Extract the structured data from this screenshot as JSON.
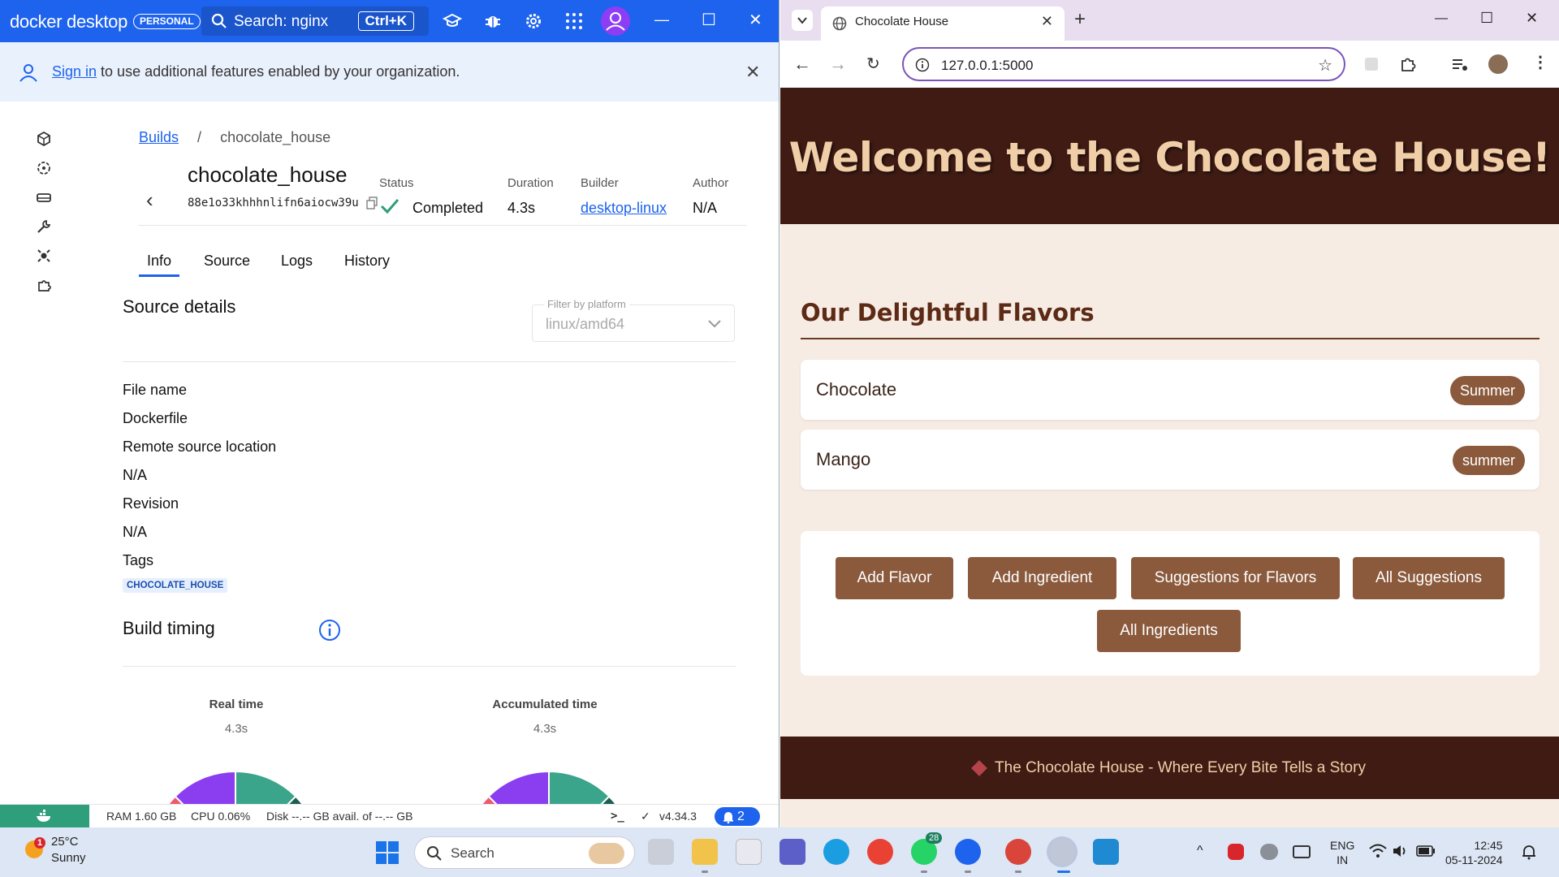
{
  "docker": {
    "logo": "docker desktop",
    "plan_badge": "PERSONAL",
    "search_label": "Search: nginx",
    "search_shortcut": "Ctrl+K",
    "banner": {
      "link": "Sign in",
      "text": " to use additional features enabled by your organization."
    },
    "breadcrumb": {
      "root": "Builds",
      "sep": "/",
      "current": "chocolate_house"
    },
    "build": {
      "name": "chocolate_house",
      "id": "88e1o33khhhnlifn6aiocw39u",
      "status_label": "Status",
      "status": "Completed",
      "duration_label": "Duration",
      "duration": "4.3s",
      "builder_label": "Builder",
      "builder": "desktop-linux",
      "author_label": "Author",
      "author": "N/A"
    },
    "tabs": [
      "Info",
      "Source",
      "Logs",
      "History"
    ],
    "source_details": {
      "title": "Source details",
      "filter_label": "Filter by platform",
      "filter_value": "linux/amd64",
      "rows": [
        "File name",
        "Dockerfile",
        "Remote source location",
        "N/A",
        "Revision",
        "N/A",
        "Tags"
      ],
      "tag": "CHOCOLATE_HOUSE"
    },
    "build_timing": {
      "title": "Build timing",
      "real_label": "Real time",
      "real_value": "4.3s",
      "acc_label": "Accumulated time",
      "acc_value": "4.3s",
      "gauge_colors": [
        "#f0596b",
        "#8a3ef0",
        "#3aa58a",
        "#1d5e52"
      ]
    },
    "status_bar": {
      "ram": "RAM 1.60 GB",
      "cpu": "CPU 0.06%",
      "disk": "Disk --.-- GB avail. of --.-- GB",
      "terminal": ">_",
      "version": "v4.34.3",
      "notifications": "2"
    }
  },
  "browser": {
    "tab_title": "Chocolate House",
    "url": "127.0.0.1:5000",
    "site": {
      "heading": "Welcome to the Chocolate House!",
      "section_title": "Our Delightful Flavors",
      "flavors": [
        {
          "name": "Chocolate",
          "season": "Summer"
        },
        {
          "name": "Mango",
          "season": "summer"
        }
      ],
      "actions": [
        "Add Flavor",
        "Add Ingredient",
        "Suggestions for Flavors",
        "All Suggestions",
        "All Ingredients"
      ],
      "footer": "The Chocolate House - Where Every Bite Tells a Story"
    }
  },
  "taskbar": {
    "weather_temp": "25°C",
    "weather_cond": "Sunny",
    "weather_alert": "1",
    "search_label": "Search",
    "whatsapp_badge": "28",
    "lang_1": "ENG",
    "lang_2": "IN",
    "time": "12:45",
    "date": "05-11-2024"
  }
}
